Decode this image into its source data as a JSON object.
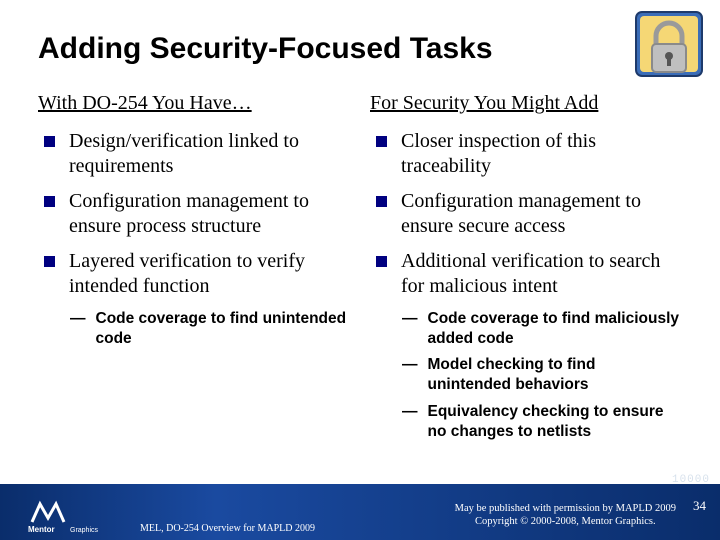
{
  "title": "Adding Security-Focused Tasks",
  "icon": "lock-icon",
  "left": {
    "heading": "With DO-254 You Have…",
    "items": [
      {
        "text": "Design/verification linked to requirements"
      },
      {
        "text": "Configuration management to ensure process structure"
      },
      {
        "text": "Layered verification to verify intended function",
        "sub": [
          "Code coverage to find unintended code"
        ]
      }
    ]
  },
  "right": {
    "heading": "For Security You Might Add",
    "items": [
      {
        "text": "Closer inspection of this traceability"
      },
      {
        "text": "Configuration management to ensure secure access"
      },
      {
        "text": "Additional verification to search for malicious intent",
        "sub": [
          "Code coverage to find maliciously added code",
          "Model checking to find unintended behaviors",
          "Equivalency checking to ensure no changes to netlists"
        ]
      }
    ]
  },
  "footer": {
    "logo": "Mentor Graphics",
    "center": "MEL, DO-254 Overview for MAPLD 2009",
    "right1": "May be published with permission by MAPLD 2009",
    "right2": "Copyright © 2000-2008, Mentor Graphics.",
    "page": "34",
    "bg_digits": "10000"
  }
}
